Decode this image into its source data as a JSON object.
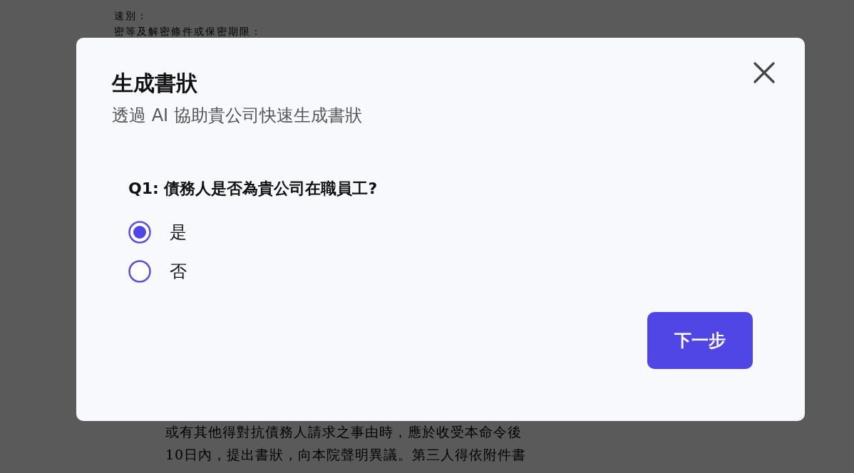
{
  "document": {
    "top_lines": [
      "速別：",
      "密等及解密條件或保密期限："
    ],
    "bottom_lines": [
      "或有其他得對抗債務人請求之事由時，應於收受本命令後",
      "10日內，提出書狀，向本院聲明異議。第三人得依附件書"
    ]
  },
  "dialog": {
    "title": "生成書狀",
    "subtitle": "透過 AI 協助貴公司快速生成書狀",
    "question": "Q1: 債務人是否為貴公司在職員工?",
    "options": [
      {
        "label": "是",
        "selected": true
      },
      {
        "label": "否",
        "selected": false
      }
    ],
    "next_button": "下一步"
  }
}
